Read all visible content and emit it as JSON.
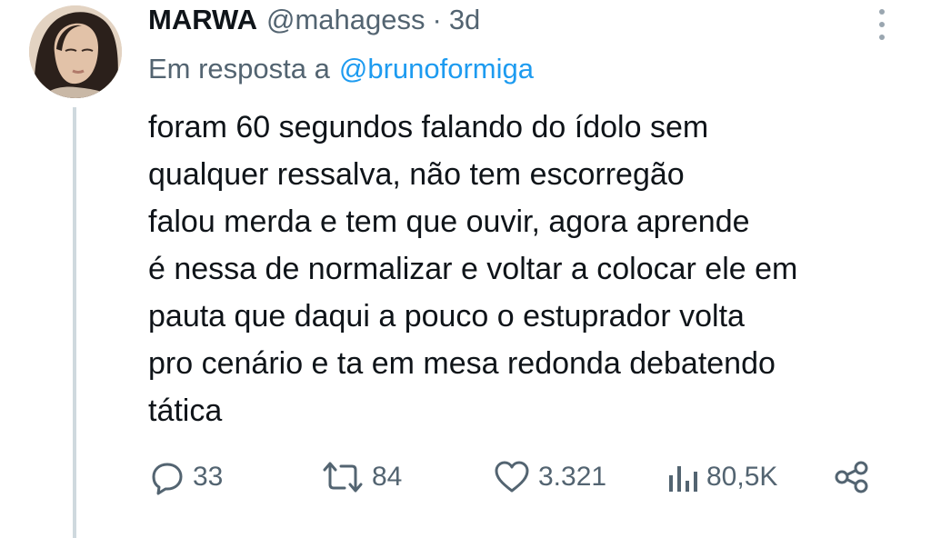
{
  "tweet": {
    "author_name": "MARWA",
    "handle": "@mahagess",
    "separator": "·",
    "time": "3d",
    "reply_prefix": "Em resposta a",
    "reply_to": "@brunoformiga",
    "body_lines": [
      "foram 60 segundos falando do ídolo sem",
      "qualquer ressalva, não tem escorregão",
      "falou merda e tem que ouvir, agora aprende",
      "é nessa de normalizar e voltar a colocar ele em",
      "pauta que daqui a pouco o estuprador volta",
      "pro cenário e ta em mesa redonda debatendo",
      "tática"
    ]
  },
  "actions": {
    "replies": "33",
    "retweets": "84",
    "likes": "3.321",
    "views": "80,5K"
  },
  "icons": {
    "reply": "reply-icon",
    "retweet": "retweet-icon",
    "like": "heart-icon",
    "views": "views-icon",
    "share": "share-icon",
    "more": "more-vertical-icon"
  },
  "colors": {
    "text": "#0f1419",
    "secondary": "#536471",
    "link": "#1d9bf0",
    "thread_line": "#cfd9de"
  }
}
